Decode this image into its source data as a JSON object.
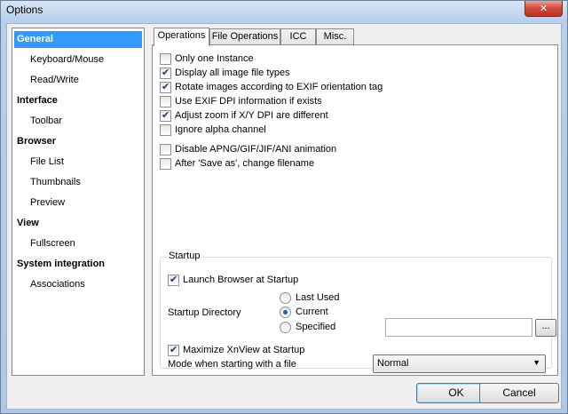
{
  "window": {
    "title": "Options",
    "close_glyph": "✕"
  },
  "tree": {
    "items": [
      {
        "label": "General",
        "kind": "cat",
        "selected": true
      },
      {
        "label": "Keyboard/Mouse",
        "kind": "sub"
      },
      {
        "label": "Read/Write",
        "kind": "sub"
      },
      {
        "label": "Interface",
        "kind": "cat"
      },
      {
        "label": "Toolbar",
        "kind": "sub"
      },
      {
        "label": "Browser",
        "kind": "cat"
      },
      {
        "label": "File List",
        "kind": "sub"
      },
      {
        "label": "Thumbnails",
        "kind": "sub"
      },
      {
        "label": "Preview",
        "kind": "sub"
      },
      {
        "label": "View",
        "kind": "cat"
      },
      {
        "label": "Fullscreen",
        "kind": "sub"
      },
      {
        "label": "System integration",
        "kind": "cat"
      },
      {
        "label": "Associations",
        "kind": "sub"
      }
    ]
  },
  "tabs": [
    {
      "label": "Operations",
      "active": true
    },
    {
      "label": "File Operations"
    },
    {
      "label": "ICC"
    },
    {
      "label": "Misc."
    }
  ],
  "options": [
    {
      "label": "Only one Instance",
      "checked": false
    },
    {
      "label": "Display all image file types",
      "checked": true
    },
    {
      "label": "Rotate images according to EXIF orientation tag",
      "checked": true
    },
    {
      "label": "Use EXIF DPI information if exists",
      "checked": false
    },
    {
      "label": "Adjust zoom if X/Y DPI are different",
      "checked": true
    },
    {
      "label": "Ignore alpha channel",
      "checked": false
    },
    {
      "label": "Disable APNG/GIF/JIF/ANI animation",
      "checked": false
    },
    {
      "label": "After 'Save as', change filename",
      "checked": false
    }
  ],
  "startup": {
    "group_label": "Startup",
    "launch_browser": {
      "label": "Launch Browser at Startup",
      "checked": true
    },
    "directory_label": "Startup Directory",
    "directory_options": [
      {
        "label": "Last Used",
        "checked": false
      },
      {
        "label": "Current",
        "checked": true
      },
      {
        "label": "Specified",
        "checked": false
      }
    ],
    "specified_path": "",
    "browse_label": "...",
    "maximize": {
      "label": "Maximize XnView at Startup",
      "checked": true
    },
    "mode_label": "Mode when starting with a file",
    "mode_value": "Normal"
  },
  "buttons": {
    "ok": "OK",
    "cancel": "Cancel"
  }
}
